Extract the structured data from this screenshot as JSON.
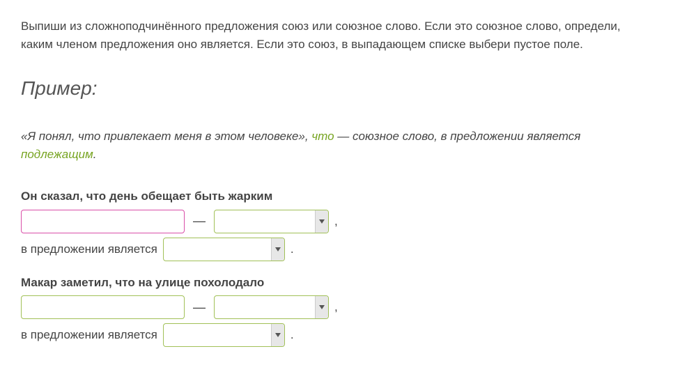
{
  "instructions": "Выпиши из сложноподчинённого предложения союз или союзное слово. Если это союзное слово, определи, каким членом предложения оно является. Если это союз, в выпадающем списке выбери пустое поле.",
  "example_heading": "Пример:",
  "example": {
    "pre": "«Я понял, что привлекает меня в этом человеке», ",
    "word": "что",
    "mid": " — союзное слово, в предложении является ",
    "role": "подлежащим",
    "post": "."
  },
  "dash": "—",
  "comma": ",",
  "period": ".",
  "member_label": "в предложении является",
  "tasks": [
    {
      "sentence": "Он сказал, что день обещает быть жарким",
      "input_value": "",
      "type_value": "",
      "role_value": "",
      "input_focused": true
    },
    {
      "sentence": "Макар заметил, что на улице похолодало",
      "input_value": "",
      "type_value": "",
      "role_value": "",
      "input_focused": false
    }
  ]
}
